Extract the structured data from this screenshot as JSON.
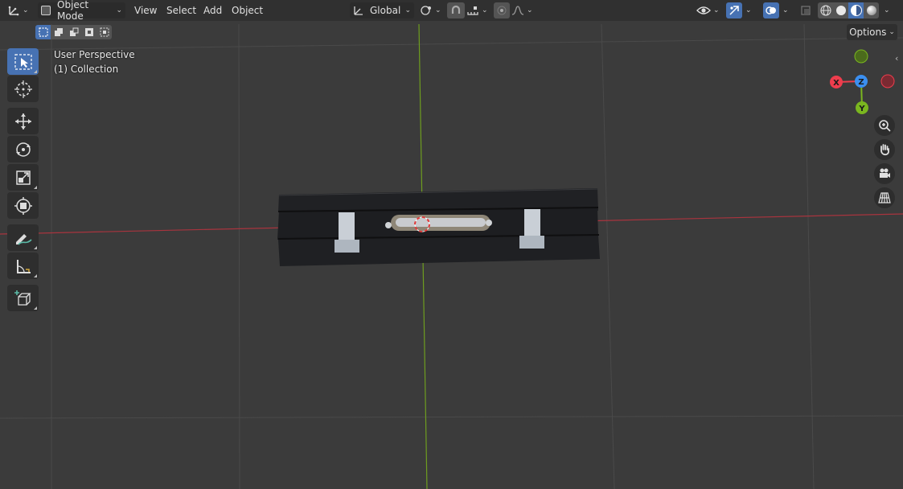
{
  "header": {
    "editor_type_icon": "axes-icon",
    "mode_label": "Object Mode",
    "menus": [
      "View",
      "Select",
      "Add",
      "Object"
    ],
    "transform_orientation": "Global",
    "options_label": "Options"
  },
  "viewport": {
    "perspective_label": "User Perspective",
    "collection_label": "(1) Collection"
  },
  "gizmo": {
    "x_label": "X",
    "y_label": "Y",
    "z_label": "Z",
    "x_color": "#ee3d4d",
    "y_color": "#7ab61f",
    "z_color": "#3b8ff0"
  },
  "toolbar": {
    "tools": [
      "select-box",
      "cursor",
      "move",
      "rotate",
      "scale",
      "transform",
      "annotate",
      "measure",
      "add-cube"
    ],
    "active_tool": "select-box"
  },
  "colors": {
    "accent": "#4772b3",
    "x_axis_line": "#b0343f",
    "y_axis_line": "#6e9d1f"
  }
}
